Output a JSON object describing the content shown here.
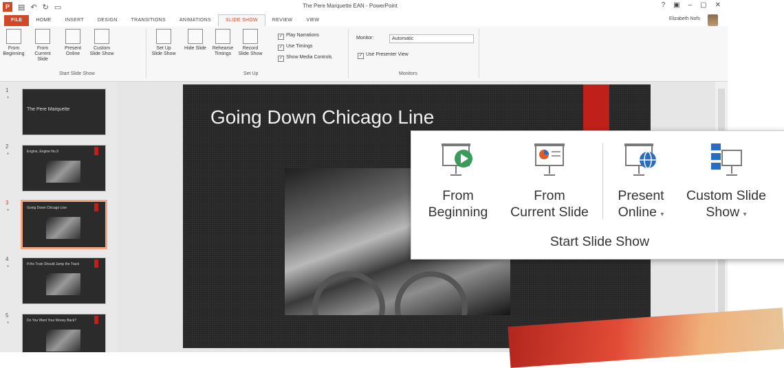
{
  "window": {
    "title": "The Pere Marquette EAN - PowerPoint",
    "user": "Elizabeth Nofs",
    "app_icon": "P"
  },
  "tabs": [
    "FILE",
    "HOME",
    "INSERT",
    "DESIGN",
    "TRANSITIONS",
    "ANIMATIONS",
    "SLIDE SHOW",
    "REVIEW",
    "VIEW"
  ],
  "active_tab": "SLIDE SHOW",
  "ribbon": {
    "start": {
      "from_beginning": "From Beginning",
      "from_current": "From Current Slide",
      "present_online": "Present Online",
      "custom_show": "Custom Slide Show",
      "label": "Start Slide Show"
    },
    "setup": {
      "setup_show": "Set Up Slide Show",
      "hide_slide": "Hide Slide",
      "rehearse": "Rehearse Timings",
      "record": "Record Slide Show",
      "play_narrations": "Play Narrations",
      "use_timings": "Use Timings",
      "show_media": "Show Media Controls",
      "label": "Set Up"
    },
    "monitors": {
      "monitor_label": "Monitor:",
      "monitor_value": "Automatic",
      "presenter_view": "Use Presenter View",
      "label": "Monitors"
    }
  },
  "slides": [
    {
      "num": "1",
      "title": "The Pere Marquette"
    },
    {
      "num": "2",
      "title": "Engine, Engine No.9"
    },
    {
      "num": "3",
      "title": "Going Down Chicago Line"
    },
    {
      "num": "4",
      "title": "If the Train Should Jump the Track"
    },
    {
      "num": "5",
      "title": "Do You Want Your Money Back?"
    }
  ],
  "current_slide": {
    "title": "Going Down Chicago Line"
  },
  "zoom_callout": {
    "from_beginning": [
      "From",
      "Beginning"
    ],
    "from_current": [
      "From",
      "Current Slide"
    ],
    "present_online": [
      "Present",
      "Online"
    ],
    "custom_show": [
      "Custom Slide",
      "Show"
    ],
    "group_label": "Start Slide Show"
  },
  "colors": {
    "accent": "#d24726",
    "slide_bg": "#262626",
    "slide_bar": "#c0201a"
  }
}
